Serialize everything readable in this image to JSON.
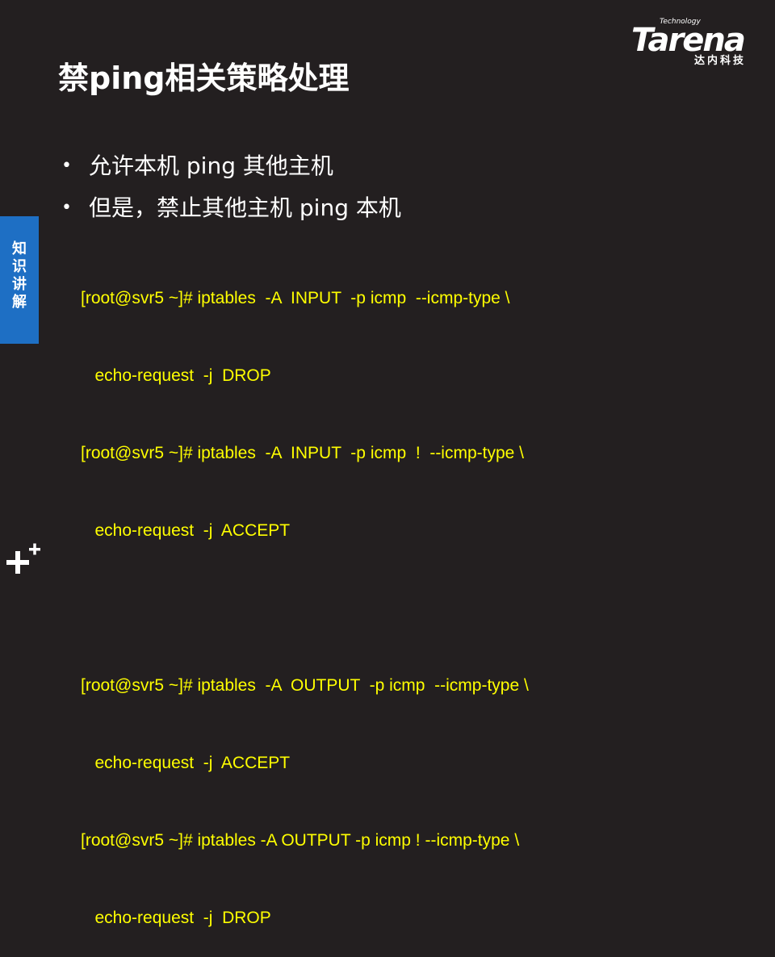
{
  "logo": {
    "tagline": "Technology",
    "name": "Tarena",
    "chinese": "达内科技"
  },
  "title": "禁ping相关策略处理",
  "bullets": [
    "允许本机 ping 其他主机",
    "但是，禁止其他主机 ping 本机"
  ],
  "side_tab": {
    "label": "知识讲解"
  },
  "code_lines": [
    "[root@svr5 ~]# iptables  -A  INPUT  -p icmp  --icmp-type \\",
    "   echo-request  -j  DROP",
    "[root@svr5 ~]# iptables  -A  INPUT  -p icmp  !  --icmp-type \\",
    "   echo-request  -j  ACCEPT",
    "",
    "[root@svr5 ~]# iptables  -A  OUTPUT  -p icmp  --icmp-type \\",
    "   echo-request  -j  ACCEPT",
    "[root@svr5 ~]# iptables -A OUTPUT -p icmp ! --icmp-type \\",
    "   echo-request  -j  DROP"
  ],
  "colors": {
    "background": "#231f20",
    "code": "#ffff00",
    "tab": "#1e6fc4"
  },
  "icons": {
    "corner": "plus-icon"
  }
}
